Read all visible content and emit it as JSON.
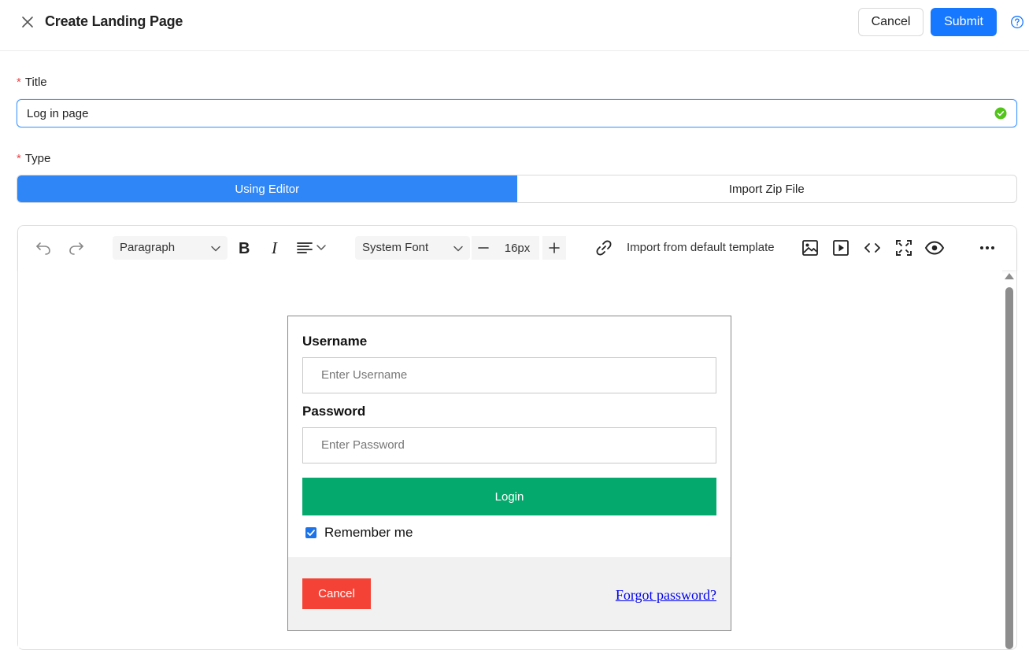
{
  "header": {
    "title": "Create Landing Page",
    "cancel_label": "Cancel",
    "submit_label": "Submit",
    "icons": {
      "close": "close-icon",
      "help": "help-circle-icon"
    }
  },
  "form": {
    "title_label": "Title",
    "title_value": "Log in page",
    "type_label": "Type",
    "type_options": [
      {
        "label": "Using Editor",
        "selected": true
      },
      {
        "label": "Import Zip File",
        "selected": false
      }
    ],
    "required_marker": "*"
  },
  "toolbar": {
    "block_format": "Paragraph",
    "font_family": "System Font",
    "font_size": "16px",
    "import_template_label": "Import from default template",
    "icons": [
      "undo-icon",
      "redo-icon",
      "bold-icon",
      "italic-icon",
      "align-left-icon",
      "decrease-size-icon",
      "increase-size-icon",
      "link-icon",
      "image-icon",
      "video-icon",
      "code-icon",
      "fullscreen-icon",
      "preview-icon",
      "more-icon"
    ]
  },
  "preview": {
    "username_label": "Username",
    "username_placeholder": "Enter Username",
    "password_label": "Password",
    "password_placeholder": "Enter Password",
    "login_label": "Login",
    "remember_label": "Remember me",
    "remember_checked": true,
    "cancel_label": "Cancel",
    "forgot_label": "Forgot password?"
  },
  "colors": {
    "primary": "#1677ff",
    "segment_active": "#2f86f6",
    "login_green": "#04aa6d",
    "cancel_red": "#f44336",
    "link_blue": "#0000ee",
    "success": "#52c41a"
  }
}
